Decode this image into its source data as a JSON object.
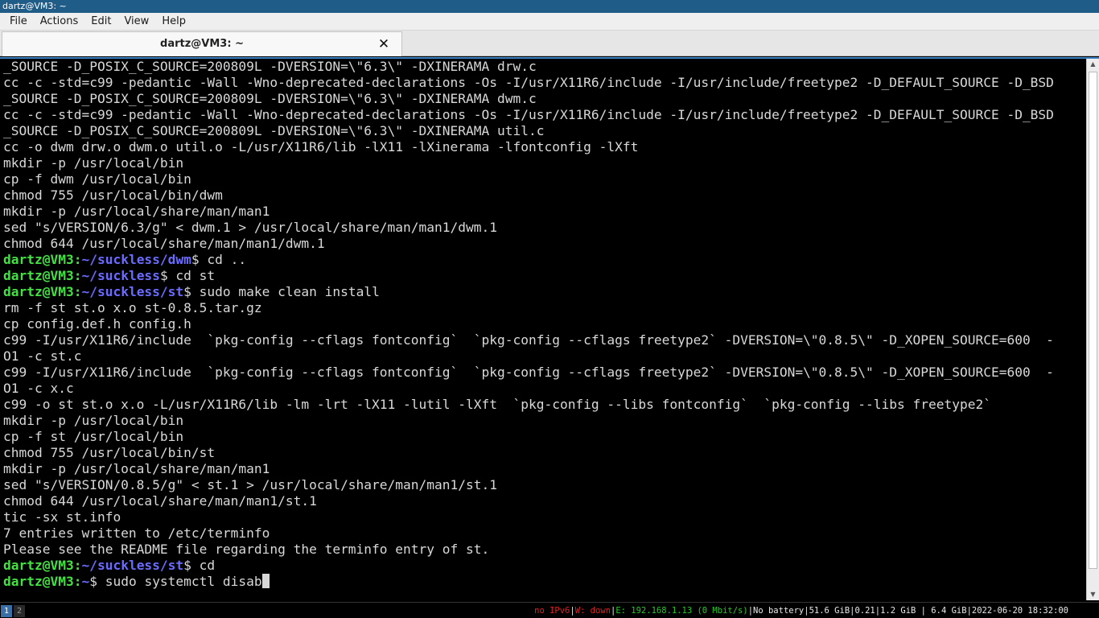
{
  "window": {
    "title": "dartz@VM3: ~"
  },
  "menu": [
    "File",
    "Actions",
    "Edit",
    "View",
    "Help"
  ],
  "tab": {
    "title": "dartz@VM3: ~",
    "close_glyph": "✕"
  },
  "terminal": {
    "lines": [
      "_SOURCE -D_POSIX_C_SOURCE=200809L -DVERSION=\\\"6.3\\\" -DXINERAMA drw.c",
      "cc -c -std=c99 -pedantic -Wall -Wno-deprecated-declarations -Os -I/usr/X11R6/include -I/usr/include/freetype2 -D_DEFAULT_SOURCE -D_BSD",
      "_SOURCE -D_POSIX_C_SOURCE=200809L -DVERSION=\\\"6.3\\\" -DXINERAMA dwm.c",
      "cc -c -std=c99 -pedantic -Wall -Wno-deprecated-declarations -Os -I/usr/X11R6/include -I/usr/include/freetype2 -D_DEFAULT_SOURCE -D_BSD",
      "_SOURCE -D_POSIX_C_SOURCE=200809L -DVERSION=\\\"6.3\\\" -DXINERAMA util.c",
      "cc -o dwm drw.o dwm.o util.o -L/usr/X11R6/lib -lX11 -lXinerama -lfontconfig -lXft",
      "mkdir -p /usr/local/bin",
      "cp -f dwm /usr/local/bin",
      "chmod 755 /usr/local/bin/dwm",
      "mkdir -p /usr/local/share/man/man1",
      "sed \"s/VERSION/6.3/g\" < dwm.1 > /usr/local/share/man/man1/dwm.1",
      "chmod 644 /usr/local/share/man/man1/dwm.1",
      {
        "user": "dartz@VM3",
        "path": "~/suckless/dwm",
        "cmd": " cd .."
      },
      {
        "user": "dartz@VM3",
        "path": "~/suckless",
        "cmd": " cd st"
      },
      {
        "user": "dartz@VM3",
        "path": "~/suckless/st",
        "cmd": " sudo make clean install"
      },
      "rm -f st st.o x.o st-0.8.5.tar.gz",
      "cp config.def.h config.h",
      "c99 -I/usr/X11R6/include  `pkg-config --cflags fontconfig`  `pkg-config --cflags freetype2` -DVERSION=\\\"0.8.5\\\" -D_XOPEN_SOURCE=600  -",
      "O1 -c st.c",
      "c99 -I/usr/X11R6/include  `pkg-config --cflags fontconfig`  `pkg-config --cflags freetype2` -DVERSION=\\\"0.8.5\\\" -D_XOPEN_SOURCE=600  -",
      "O1 -c x.c",
      "c99 -o st st.o x.o -L/usr/X11R6/lib -lm -lrt -lX11 -lutil -lXft  `pkg-config --libs fontconfig`  `pkg-config --libs freetype2`",
      "mkdir -p /usr/local/bin",
      "cp -f st /usr/local/bin",
      "chmod 755 /usr/local/bin/st",
      "mkdir -p /usr/local/share/man/man1",
      "sed \"s/VERSION/0.8.5/g\" < st.1 > /usr/local/share/man/man1/st.1",
      "chmod 644 /usr/local/share/man/man1/st.1",
      "tic -sx st.info",
      "7 entries written to /etc/terminfo",
      "Please see the README file regarding the terminfo entry of st.",
      {
        "user": "dartz@VM3",
        "path": "~/suckless/st",
        "cmd": " cd"
      },
      {
        "user": "dartz@VM3",
        "path": "~",
        "cmd": " sudo systemctl disab",
        "cursor": true
      }
    ]
  },
  "scrollbar": {
    "up_glyph": "▲",
    "down_glyph": "▼"
  },
  "statusbar": {
    "workspaces": [
      "1",
      "2"
    ],
    "ipv6": "no IPv6",
    "wireless": "W: down",
    "ethernet": "E: 192.168.1.13 (0 Mbit/s)",
    "battery": "No battery",
    "disk": "51.6 GiB",
    "load": "0.21",
    "memory": "1.2 GiB | 6.4 GiB",
    "datetime": "2022-06-20 18:32:00"
  },
  "colors": {
    "prompt_user": "#44e044",
    "prompt_path": "#6b6bff",
    "text": "#d8d8d8",
    "accent": "#3b82c4"
  }
}
